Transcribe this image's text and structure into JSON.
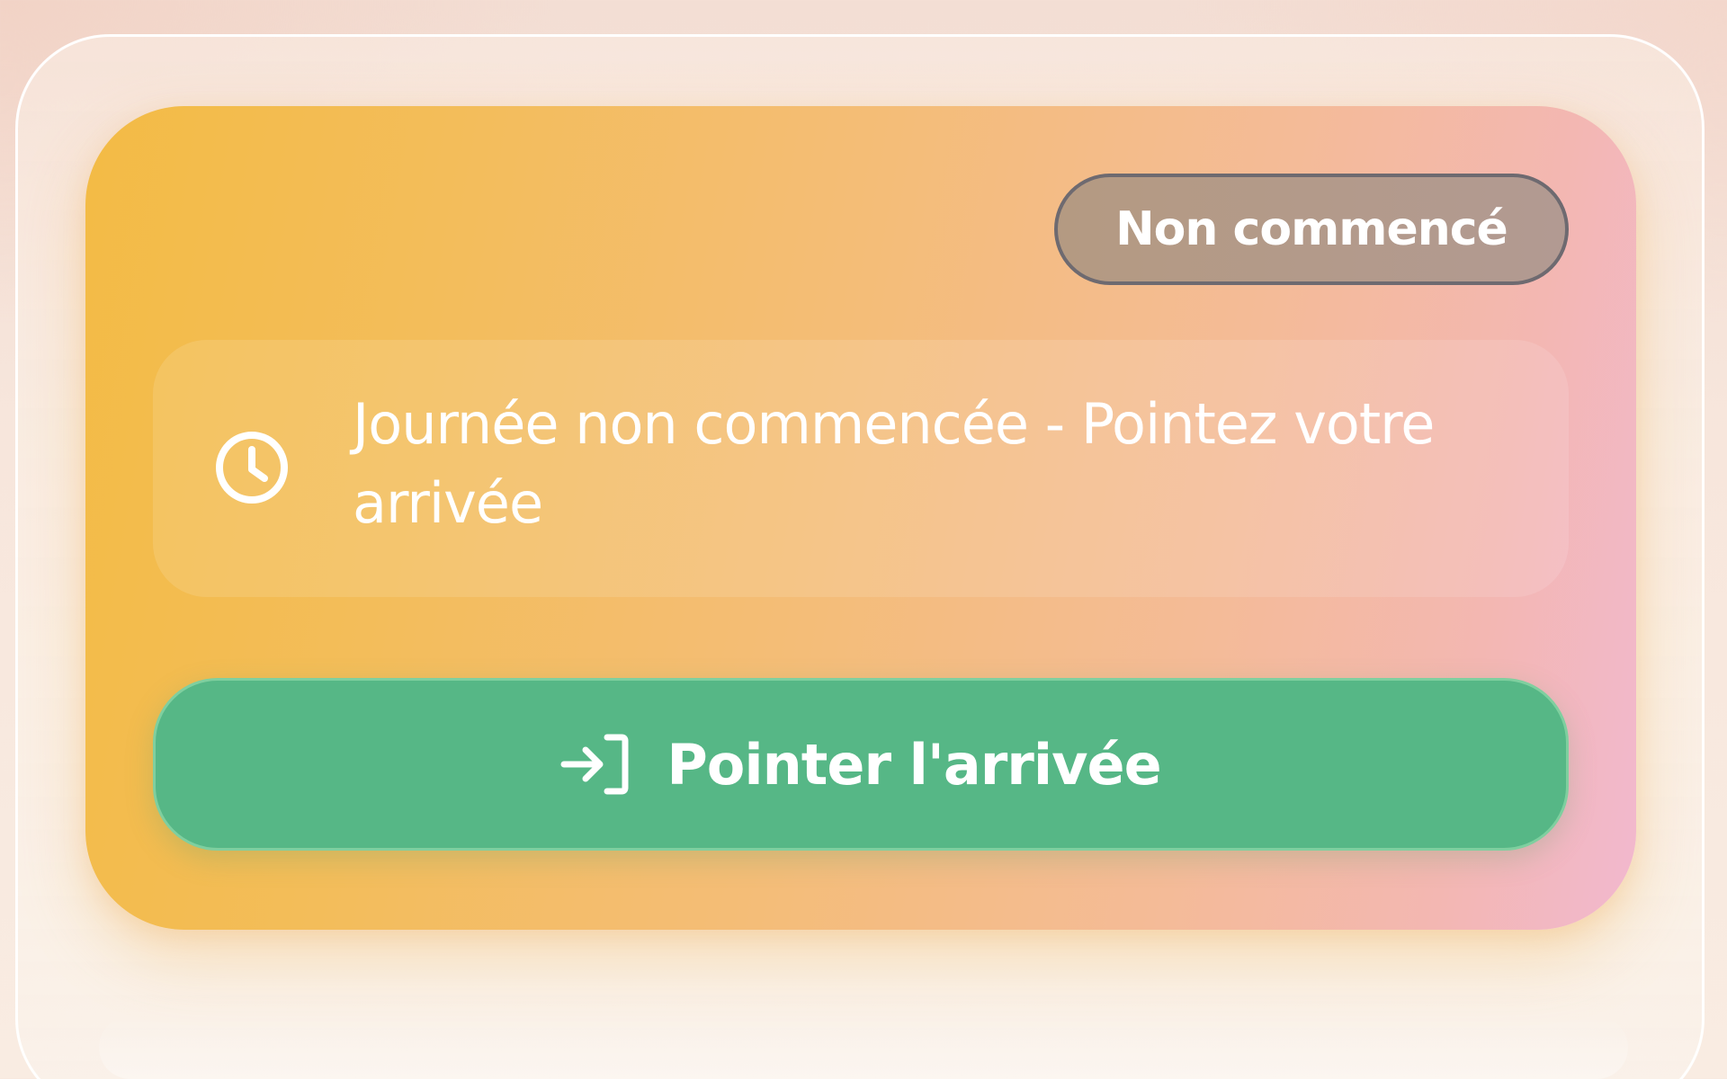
{
  "status_card": {
    "badge_label": "Non commencé",
    "message": "Journée non commencée - Pointez votre arrivée",
    "message_icon": "clock-icon",
    "action_button": {
      "label": "Pointer l'arrivée",
      "icon": "login-icon"
    }
  },
  "colors": {
    "card_gradient_start": "#f3bb45",
    "card_gradient_end": "#f2b8cf",
    "badge_border": "#6e6a70",
    "button_green": "#56b786",
    "text": "#ffffff"
  }
}
